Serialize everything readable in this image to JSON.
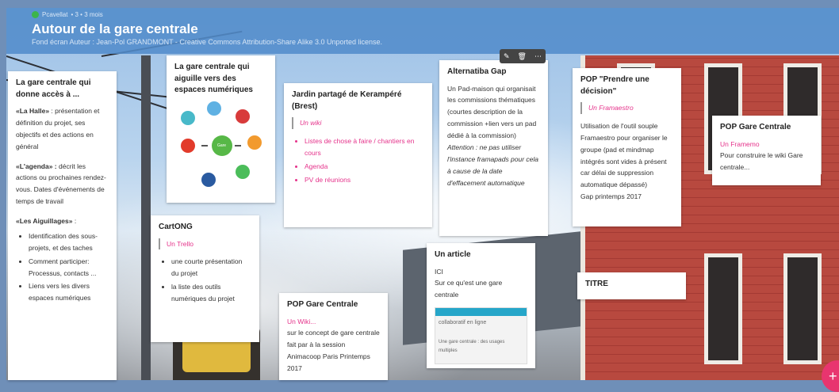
{
  "header": {
    "author": "Pcavellat",
    "meta": "• 3 • 3 mois",
    "title": "Autour de la gare centrale",
    "subtitle": "Fond écran Auteur : Jean-Pol GRANDMONT - Creative Commons Attribution-Share Alike 3.0 Unported license."
  },
  "toolbar": {
    "edit": "✎",
    "delete": "🗑",
    "more": "⋯"
  },
  "cards": {
    "c1": {
      "title": "La gare centrale qui donne accès à ...",
      "p1_bold": "«La Halle»",
      "p1": " : présentation et définition du projet, ses objectifs et des actions en général",
      "p2_bold": "«L'agenda» :",
      "p2": " décrit les actions ou prochaines rendez-vous. Dates d'événements de temps de travail",
      "p3_bold": "«Les Aiguillages»",
      "p3": " :",
      "items": [
        "Identification des sous-projets, et des taches",
        "Comment participer: Processus, contacts ...",
        "Liens vers les divers espaces numériques"
      ]
    },
    "c2": {
      "title": "La gare centrale qui aiguille vers des espaces numériques",
      "center": "Gare centrale"
    },
    "c3": {
      "title": "CartONG",
      "link": "Un Trello",
      "items": [
        "une courte présentation du projet",
        "la liste des outils numériques du projet"
      ]
    },
    "c4": {
      "title": "Jardin partagé de Kerampéré (Brest)",
      "link": "Un wiki",
      "items": [
        "Listes de chose à faire / chantiers en cours",
        "Agenda",
        "PV de réunions"
      ]
    },
    "c5": {
      "title": "POP Gare Centrale",
      "link": "Un Wiki...",
      "text": "sur le concept de gare centrale fait par à la session Animacoop Paris Printemps 2017"
    },
    "c6": {
      "title": "Alternatiba Gap",
      "text": "Un Pad-maison qui organisait les commissions thématiques (courtes description de la commission +lien vers un pad dédié à la commission)",
      "italic": "Attention : ne pas utiliser l'instance framapads pour cela à cause de la date d'effacement automatique"
    },
    "c7": {
      "title": "Un article",
      "l1": "ICI",
      "l2": "Sur ce qu'est une gare centrale",
      "thumb_caption": "Une gare centrale : des usages multiples",
      "thumb_line": "collaboratif en ligne"
    },
    "c8": {
      "title": "POP \"Prendre une décision\"",
      "link": "Un Framaestro",
      "text": "Utilisation de l'outil souple Framaestro pour organiser le groupe (pad et mindmap intégrés sont vides à présent car délai de suppression automatique dépassé)",
      "footer": "Gap printemps 2017"
    },
    "c9": {
      "title": "POP Gare Centrale",
      "link": "Un Framemo",
      "text": "Pour construire le wiki Gare centrale..."
    },
    "c10": {
      "title": "TITRE"
    }
  },
  "fab": {
    "label": "+"
  }
}
